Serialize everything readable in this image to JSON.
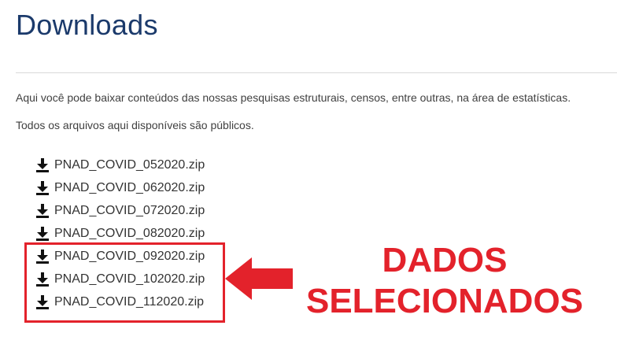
{
  "header": {
    "title": "Downloads"
  },
  "intro": {
    "line1": "Aqui você pode baixar conteúdos das nossas pesquisas estruturais, censos, entre outras, na área de estatísticas.",
    "line2": "Todos os arquivos aqui disponíveis são públicos."
  },
  "files": [
    {
      "name": "PNAD_COVID_052020.zip",
      "icon": "download-icon"
    },
    {
      "name": "PNAD_COVID_062020.zip",
      "icon": "download-icon"
    },
    {
      "name": "PNAD_COVID_072020.zip",
      "icon": "download-icon"
    },
    {
      "name": "PNAD_COVID_082020.zip",
      "icon": "download-icon"
    },
    {
      "name": "PNAD_COVID_092020.zip",
      "icon": "download-icon"
    },
    {
      "name": "PNAD_COVID_102020.zip",
      "icon": "download-icon"
    },
    {
      "name": "PNAD_COVID_112020.zip",
      "icon": "download-icon"
    }
  ],
  "annotation": {
    "line1": "DADOS",
    "line2": "SELECIONADOS",
    "color": "#e3222b"
  },
  "colors": {
    "title": "#1b3a6b",
    "text": "#333333",
    "accent": "#e3222b"
  }
}
